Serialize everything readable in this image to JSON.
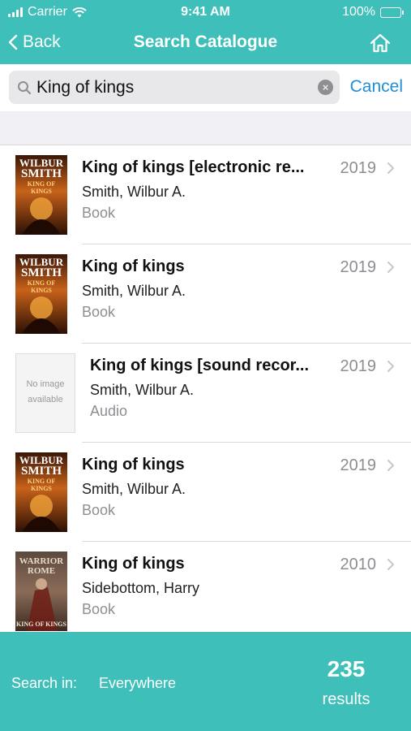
{
  "status_bar": {
    "carrier": "Carrier",
    "time": "9:41 AM",
    "battery": "100%"
  },
  "nav": {
    "back_label": "Back",
    "title": "Search Catalogue"
  },
  "search": {
    "query": "King of kings",
    "cancel_label": "Cancel",
    "clear_icon": "clear-icon"
  },
  "results": [
    {
      "title": "King of kings [electronic re...",
      "author": "Smith, Wilbur A.",
      "format": "Book",
      "year": "2019",
      "cover_text": [
        "WILBUR",
        "SMITH",
        "KING OF",
        "KINGS"
      ],
      "cover": "wilbur"
    },
    {
      "title": "King of kings",
      "author": "Smith, Wilbur A.",
      "format": "Book",
      "year": "2019",
      "cover_text": [
        "WILBUR",
        "SMITH",
        "KING OF",
        "KINGS"
      ],
      "cover": "wilbur"
    },
    {
      "title": "King of kings [sound recor...",
      "author": "Smith, Wilbur A.",
      "format": "Audio",
      "year": "2019",
      "placeholder_lines": [
        "No image",
        "available"
      ],
      "cover": "none"
    },
    {
      "title": "King of kings",
      "author": "Smith, Wilbur A.",
      "format": "Book",
      "year": "2019",
      "cover_text": [
        "WILBUR",
        "SMITH",
        "KING OF",
        "KINGS"
      ],
      "cover": "wilbur"
    },
    {
      "title": "King of kings",
      "author": "Sidebottom, Harry",
      "format": "Book",
      "year": "2010",
      "cover_text": [
        "WARRIOR",
        "ROME",
        "KING OF KINGS"
      ],
      "cover": "warrior"
    }
  ],
  "footer": {
    "search_in_label": "Search in:",
    "scope": "Everywhere",
    "count": "235",
    "count_label": "results"
  },
  "colors": {
    "accent": "#3ebfb9",
    "link": "#1e8fd6",
    "secondary_text": "#8e8e93"
  }
}
